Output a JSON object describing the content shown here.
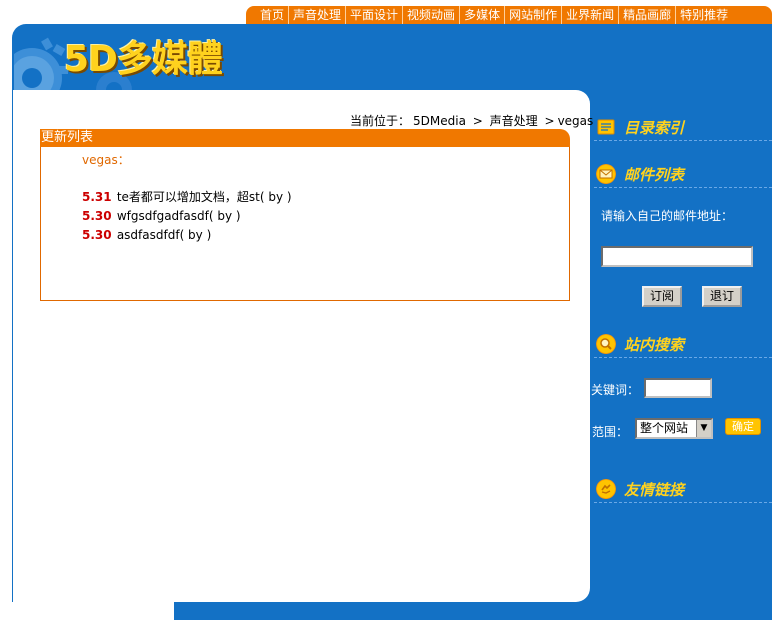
{
  "nav": {
    "items": [
      "首页",
      "声音处理",
      "平面设计",
      "视频动画",
      "多媒体",
      "网站制作",
      "业界新闻",
      "精品画廊",
      "特别推荐"
    ]
  },
  "logo": {
    "text": "5D多媒體"
  },
  "breadcrumb": {
    "prefix": "当前位于：",
    "site": "5DMedia",
    "sep1": ">",
    "category": "声音处理",
    "sep2": ">",
    "current": "vegas"
  },
  "updates": {
    "title": "更新列表",
    "category": "vegas：",
    "entries": [
      {
        "date": "5.31",
        "title": "te者都可以增加文档，超st( by )"
      },
      {
        "date": "5.30",
        "title": "wfgsdfgadfasdf( by )"
      },
      {
        "date": "5.30",
        "title": "asdfasdfdf( by )"
      }
    ]
  },
  "sidebar": {
    "index_title": "目录索引",
    "mail_title": "邮件列表",
    "mail_prompt": "请输入自己的邮件地址：",
    "mail_value": "",
    "subscribe_label": "订阅",
    "unsubscribe_label": "退订",
    "search_title": "站内搜索",
    "keyword_label": "关键词：",
    "keyword_value": "",
    "range_label": "范围：",
    "range_selected": "整个网站",
    "ok_label": "确定",
    "links_title": "友情链接"
  },
  "colors": {
    "blue": "#1371c5",
    "orange": "#f07800",
    "gold": "#ffd21e",
    "date_red": "#cc0000"
  }
}
